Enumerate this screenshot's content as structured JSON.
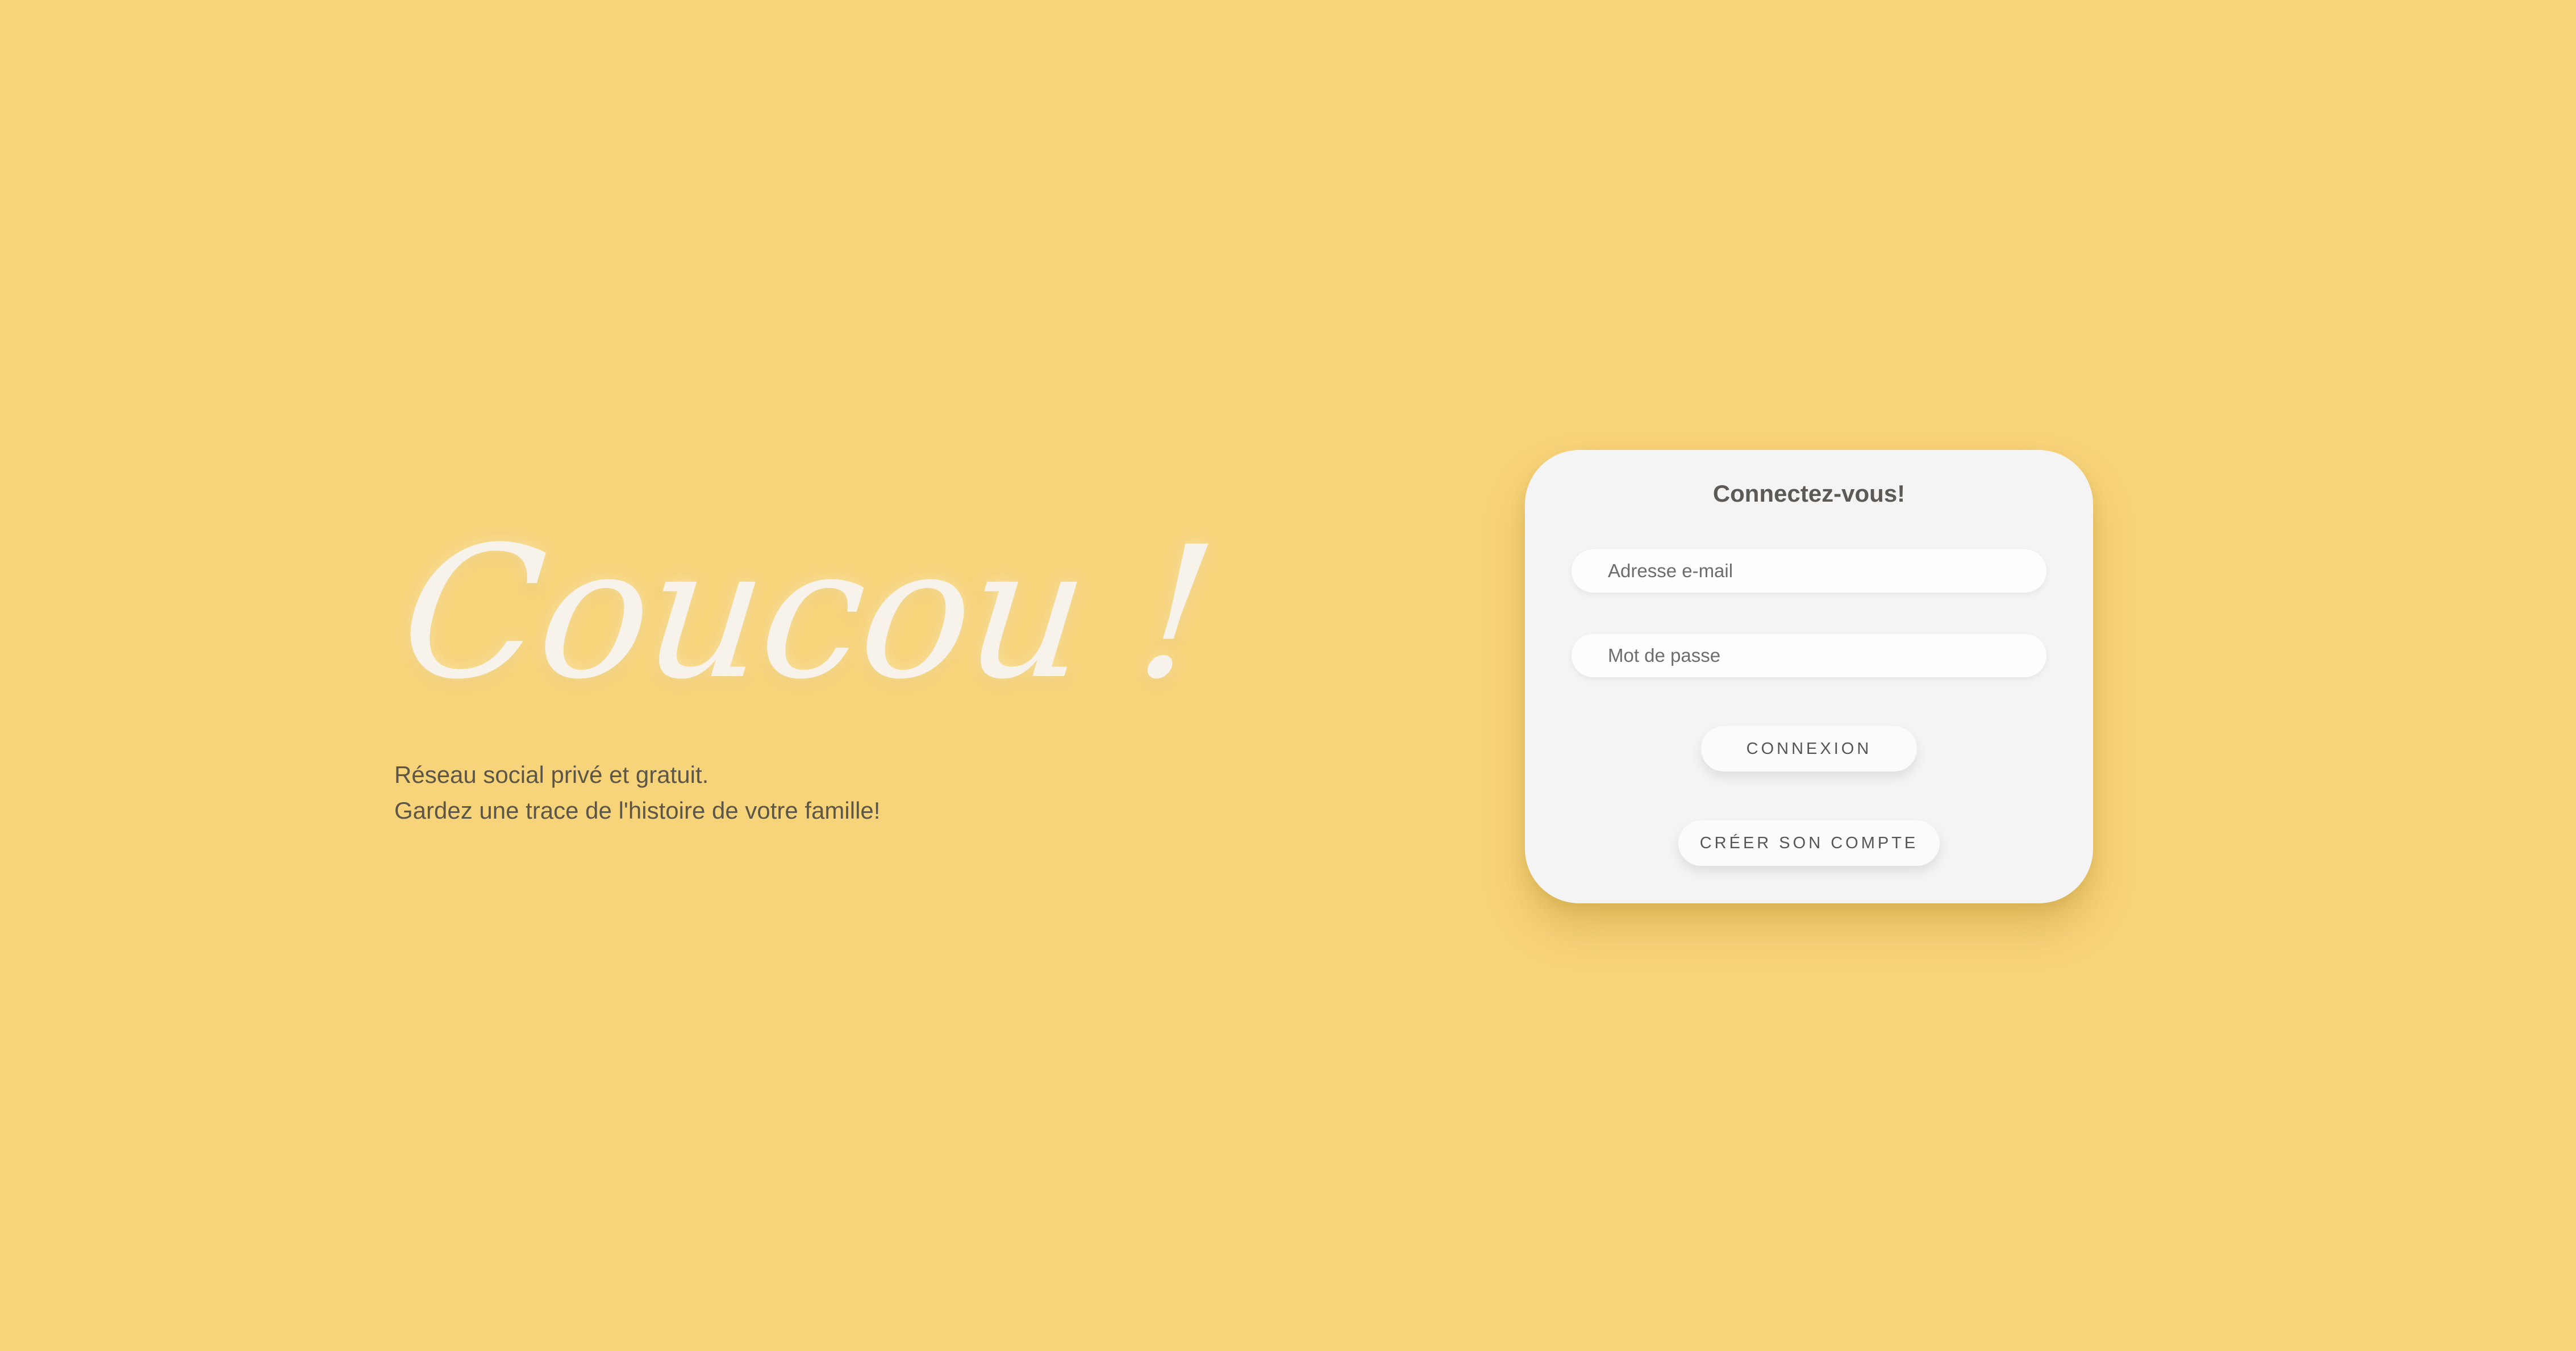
{
  "page": {
    "background_color": "#f7d37a"
  },
  "hero": {
    "title": "Coucou !",
    "lines": [
      "Réseau social privé et gratuit.",
      "Gardez une trace de l'histoire de votre famille!"
    ]
  },
  "login": {
    "title": "Connectez-vous!",
    "email_placeholder": "Adresse e-mail",
    "password_placeholder": "Mot de passe",
    "login_label": "CONNEXION",
    "create_account_label": "CRÉER SON COMPTE"
  },
  "colors": {
    "card_background": "#f4f4f4",
    "accent_yellow": "#f7d37a",
    "text_dark": "#5c5648"
  }
}
